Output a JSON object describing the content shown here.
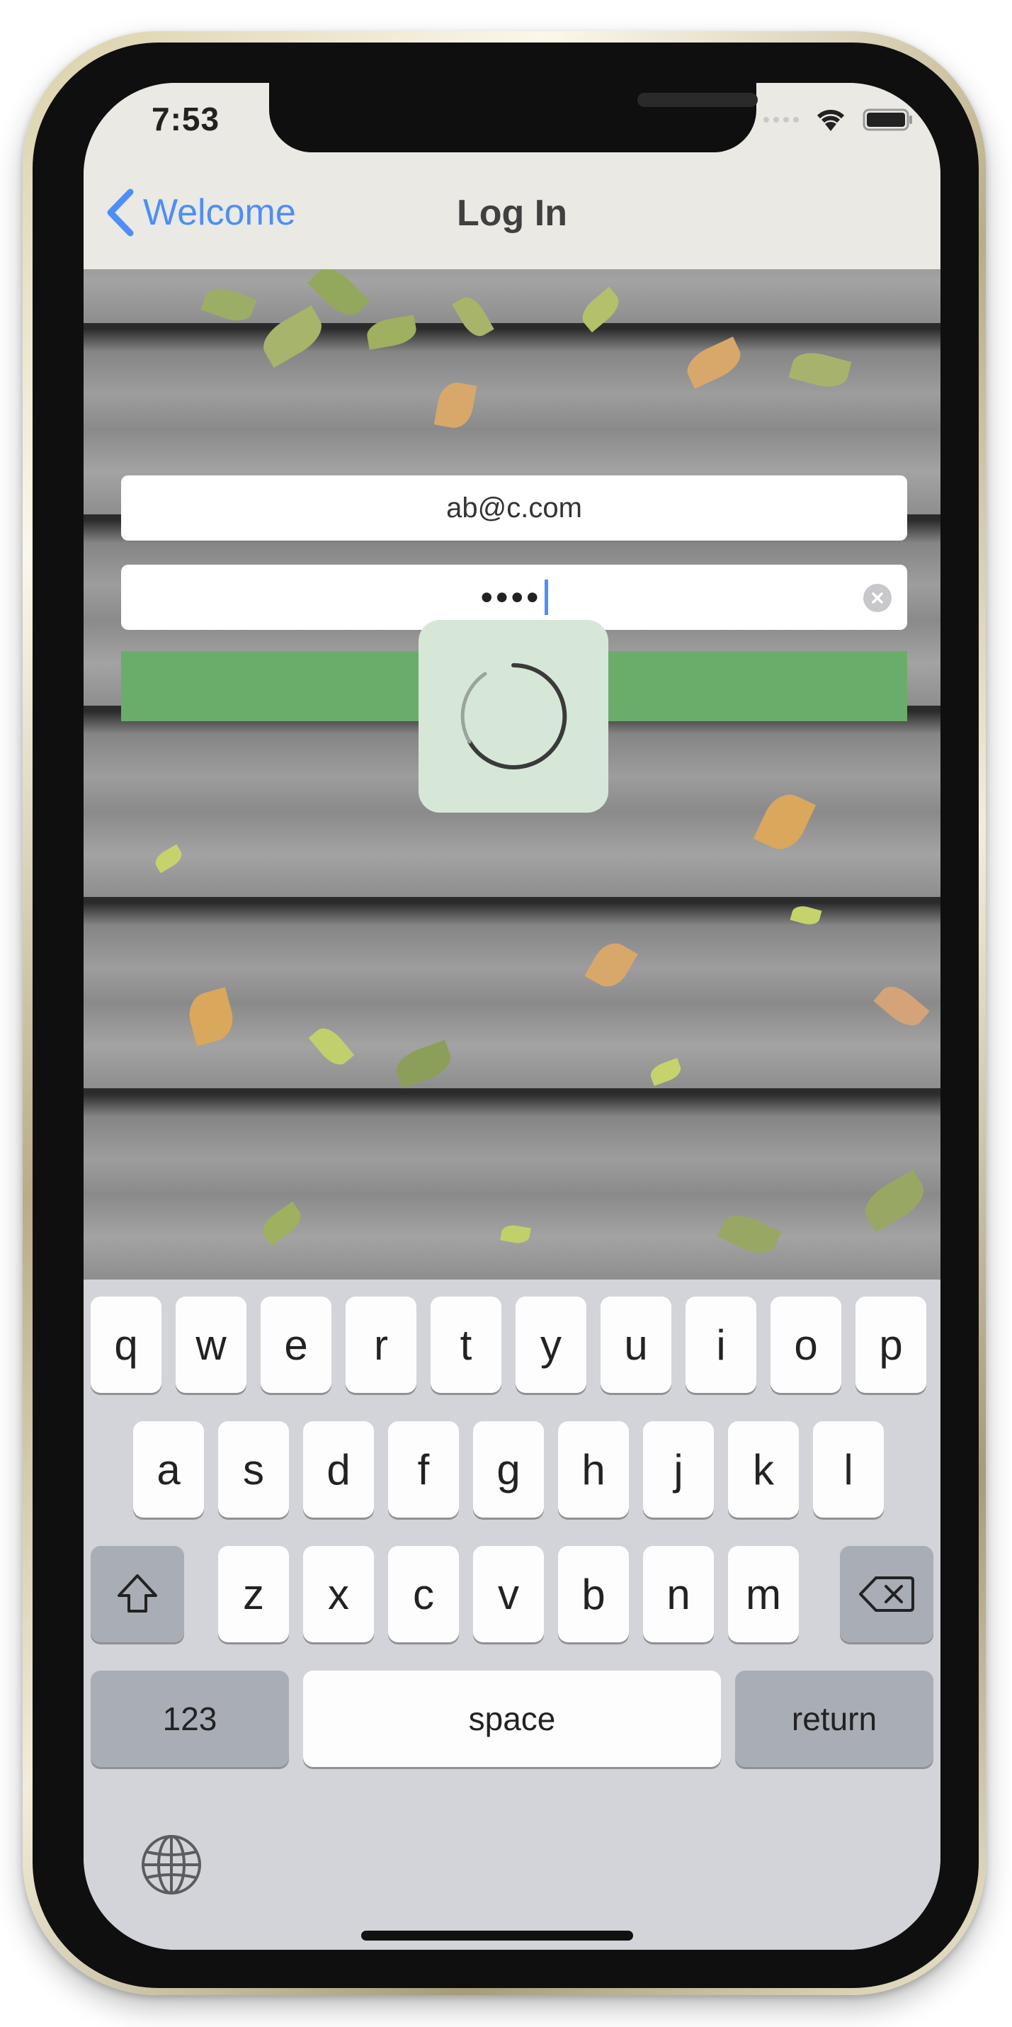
{
  "status": {
    "time": "7:53"
  },
  "nav": {
    "back_label": "Welcome",
    "title": "Log In"
  },
  "form": {
    "email_value": "ab@c.com",
    "password_masked": "••••",
    "loading": true
  },
  "keyboard": {
    "row1": [
      "q",
      "w",
      "e",
      "r",
      "t",
      "y",
      "u",
      "i",
      "o",
      "p"
    ],
    "row2": [
      "a",
      "s",
      "d",
      "f",
      "g",
      "h",
      "j",
      "k",
      "l"
    ],
    "row3": [
      "z",
      "x",
      "c",
      "v",
      "b",
      "n",
      "m"
    ],
    "numbers_label": "123",
    "space_label": "space",
    "return_label": "return"
  },
  "colors": {
    "accent": "#4d8ff6",
    "button_green": "#6aad6a"
  },
  "icons": [
    "chevron-left-icon",
    "wifi-icon",
    "battery-icon",
    "clear-icon",
    "spinner-icon",
    "shift-icon",
    "delete-icon",
    "globe-icon"
  ]
}
